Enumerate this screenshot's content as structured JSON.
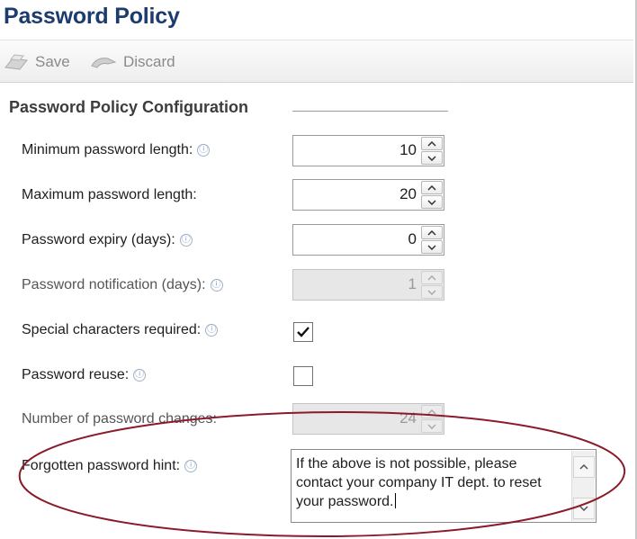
{
  "page": {
    "title": "Password Policy"
  },
  "toolbar": {
    "save_label": "Save",
    "discard_label": "Discard"
  },
  "group": {
    "title": "Password Policy Configuration"
  },
  "fields": {
    "min_length": {
      "label": "Minimum password length:",
      "value": "10"
    },
    "max_length": {
      "label": "Maximum password length:",
      "value": "20"
    },
    "expiry": {
      "label": "Password expiry (days):",
      "value": "0"
    },
    "notification": {
      "label": "Password notification (days):",
      "value": "1"
    },
    "special_chars": {
      "label": "Special characters required:",
      "checked": true
    },
    "reuse": {
      "label": "Password reuse:",
      "checked": false
    },
    "num_changes": {
      "label": "Number of password changes:",
      "value": "24"
    },
    "hint": {
      "label": "Forgotten password hint:",
      "value": "If the above is not possible, please contact your company IT dept. to reset your password."
    }
  },
  "colors": {
    "title": "#1c3b6e",
    "annotation": "#8b1a2b"
  },
  "icons": {
    "info": "ⓘ",
    "check": "check-icon"
  }
}
